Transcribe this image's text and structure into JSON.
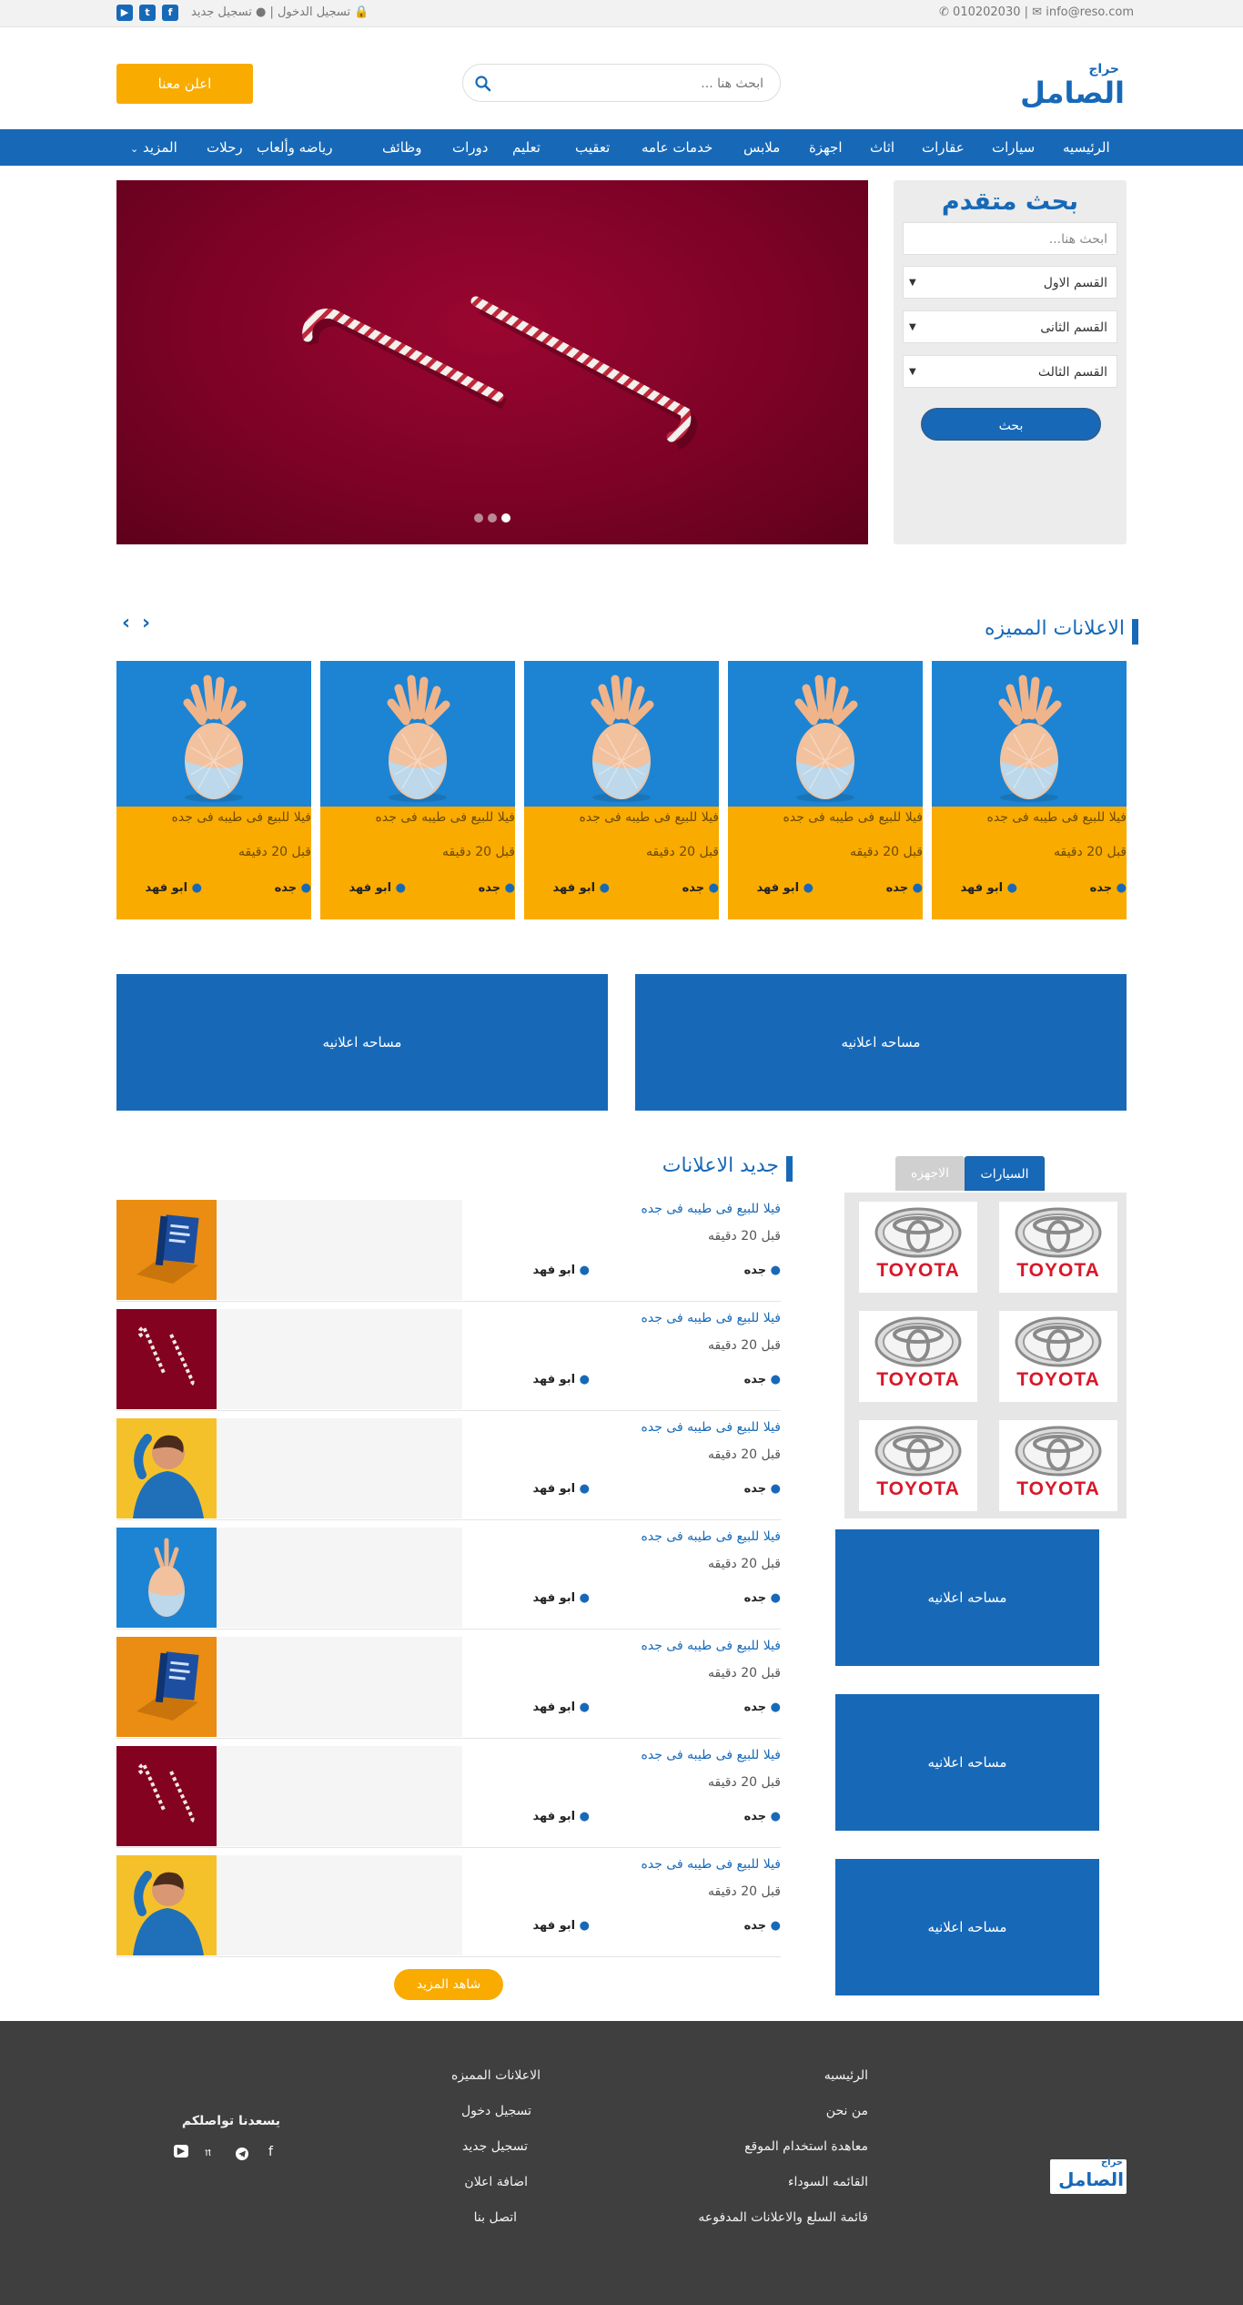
{
  "topbar": {
    "email": "info@reso.com",
    "separator": "|",
    "phone": "010202030",
    "login": "تسجيل الدخول",
    "register": "تسجيل جديد",
    "social": [
      "youtube-icon",
      "twitter-icon",
      "facebook-icon"
    ]
  },
  "header": {
    "logo_small": "حراج",
    "logo_big": "الصامل",
    "search_placeholder": "ابحث هنا ...",
    "advertise_label": "اعلن معنا"
  },
  "nav": {
    "items": [
      "الرئيسيه",
      "سيارات",
      "عقارات",
      "اثاث",
      "اجهزة",
      "ملابس",
      "خدمات عامه",
      "تعقيب",
      "تعليم",
      "دورات",
      "وظائف",
      "رياضه وألعاب",
      "رحلات",
      "المزيد"
    ]
  },
  "advanced_search": {
    "title": "بحث متقدم",
    "placeholder": "ابحث هنا...",
    "section_1": "القسم الاول",
    "section_2": "القسم الثانى",
    "section_3": "القسم الثالث",
    "button": "بحث"
  },
  "featured": {
    "title": "الاعلانات المميزه",
    "cards": [
      {
        "title": "فيلا للبيع فى طيبه فى جده",
        "time": "قبل 20 دقيقه",
        "city": "جده",
        "user": "ابو فهد"
      },
      {
        "title": "فيلا للبيع فى طيبه فى جده",
        "time": "قبل 20 دقيقه",
        "city": "جده",
        "user": "ابو فهد"
      },
      {
        "title": "فيلا للبيع فى طيبه فى جده",
        "time": "قبل 20 دقيقه",
        "city": "جده",
        "user": "ابو فهد"
      },
      {
        "title": "فيلا للبيع فى طيبه فى جده",
        "time": "قبل 20 دقيقه",
        "city": "جده",
        "user": "ابو فهد"
      },
      {
        "title": "فيلا للبيع فى طيبه فى جده",
        "time": "قبل 20 دقيقه",
        "city": "جده",
        "user": "ابو فهد"
      }
    ]
  },
  "ad_space": "مساحه اعلانيه",
  "latest": {
    "title": "جديد الاعلانات",
    "items": [
      {
        "title": "فيلا للبيع فى طيبه فى جده",
        "time": "قبل 20 دقيقه",
        "city": "جده",
        "user": "ابو فهد",
        "thumb": "book"
      },
      {
        "title": "فيلا للبيع فى طيبه فى جده",
        "time": "قبل 20 دقيقه",
        "city": "جده",
        "user": "ابو فهد",
        "thumb": "candy"
      },
      {
        "title": "فيلا للبيع فى طيبه فى جده",
        "time": "قبل 20 دقيقه",
        "city": "جده",
        "user": "ابو فهد",
        "thumb": "person"
      },
      {
        "title": "فيلا للبيع فى طيبه فى جده",
        "time": "قبل 20 دقيقه",
        "city": "جده",
        "user": "ابو فهد",
        "thumb": "pineapple"
      },
      {
        "title": "فيلا للبيع فى طيبه فى جده",
        "time": "قبل 20 دقيقه",
        "city": "جده",
        "user": "ابو فهد",
        "thumb": "book"
      },
      {
        "title": "فيلا للبيع فى طيبه فى جده",
        "time": "قبل 20 دقيقه",
        "city": "جده",
        "user": "ابو فهد",
        "thumb": "candy"
      },
      {
        "title": "فيلا للبيع فى طيبه فى جده",
        "time": "قبل 20 دقيقه",
        "city": "جده",
        "user": "ابو فهد",
        "thumb": "person"
      }
    ],
    "more_label": "شاهد المزيد"
  },
  "brands": {
    "tab_cars": "السيارات",
    "tab_devices": "الاجهزه",
    "brand_name": "TOYOTA"
  },
  "footer": {
    "col1": [
      "الرئيسيه",
      "من نحن",
      "معاهدة استخدام الموقع",
      "القائمه السوداء",
      "قائمة السلع والاعلانات المدفوعه"
    ],
    "col2": [
      "الاعلانات المميزه",
      "تسجيل دخول",
      "تسجيل جديد",
      "اضافة اعلان",
      "اتصل بنا"
    ],
    "social_title": "يسعدنا تواصلكم",
    "social": [
      "facebook-icon",
      "telegram-icon",
      "twitter-icon",
      "youtube-icon"
    ]
  },
  "colors": {
    "primary": "#1769b8",
    "accent": "#f9ab00",
    "footer": "#3f3f3f"
  }
}
